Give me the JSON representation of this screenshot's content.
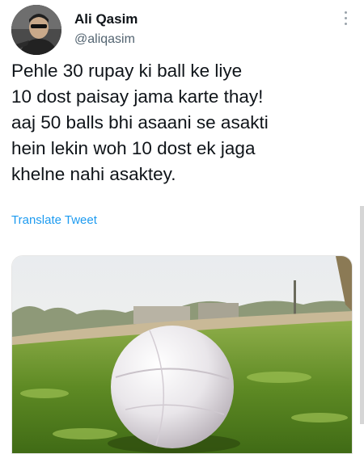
{
  "tweet": {
    "author": {
      "name": "Ali Qasim",
      "handle": "@aliqasim",
      "avatar_icon": "profile-photo"
    },
    "more_icon": "more-vertical-icon",
    "text_lines": [
      "Pehle 30 rupay ki ball ke liye",
      "10 dost paisay jama karte thay!",
      "aaj 50 balls bhi asaani se asakti",
      "hein lekin woh 10 dost ek jaga",
      "khelne nahi asaktey."
    ],
    "translate_label": "Translate Tweet",
    "media": {
      "kind": "photo",
      "subject": "taped tennis ball on grass"
    }
  },
  "colors": {
    "text": "#0f1419",
    "secondary": "#536471",
    "link": "#1d9bf0",
    "background": "#ffffff"
  }
}
